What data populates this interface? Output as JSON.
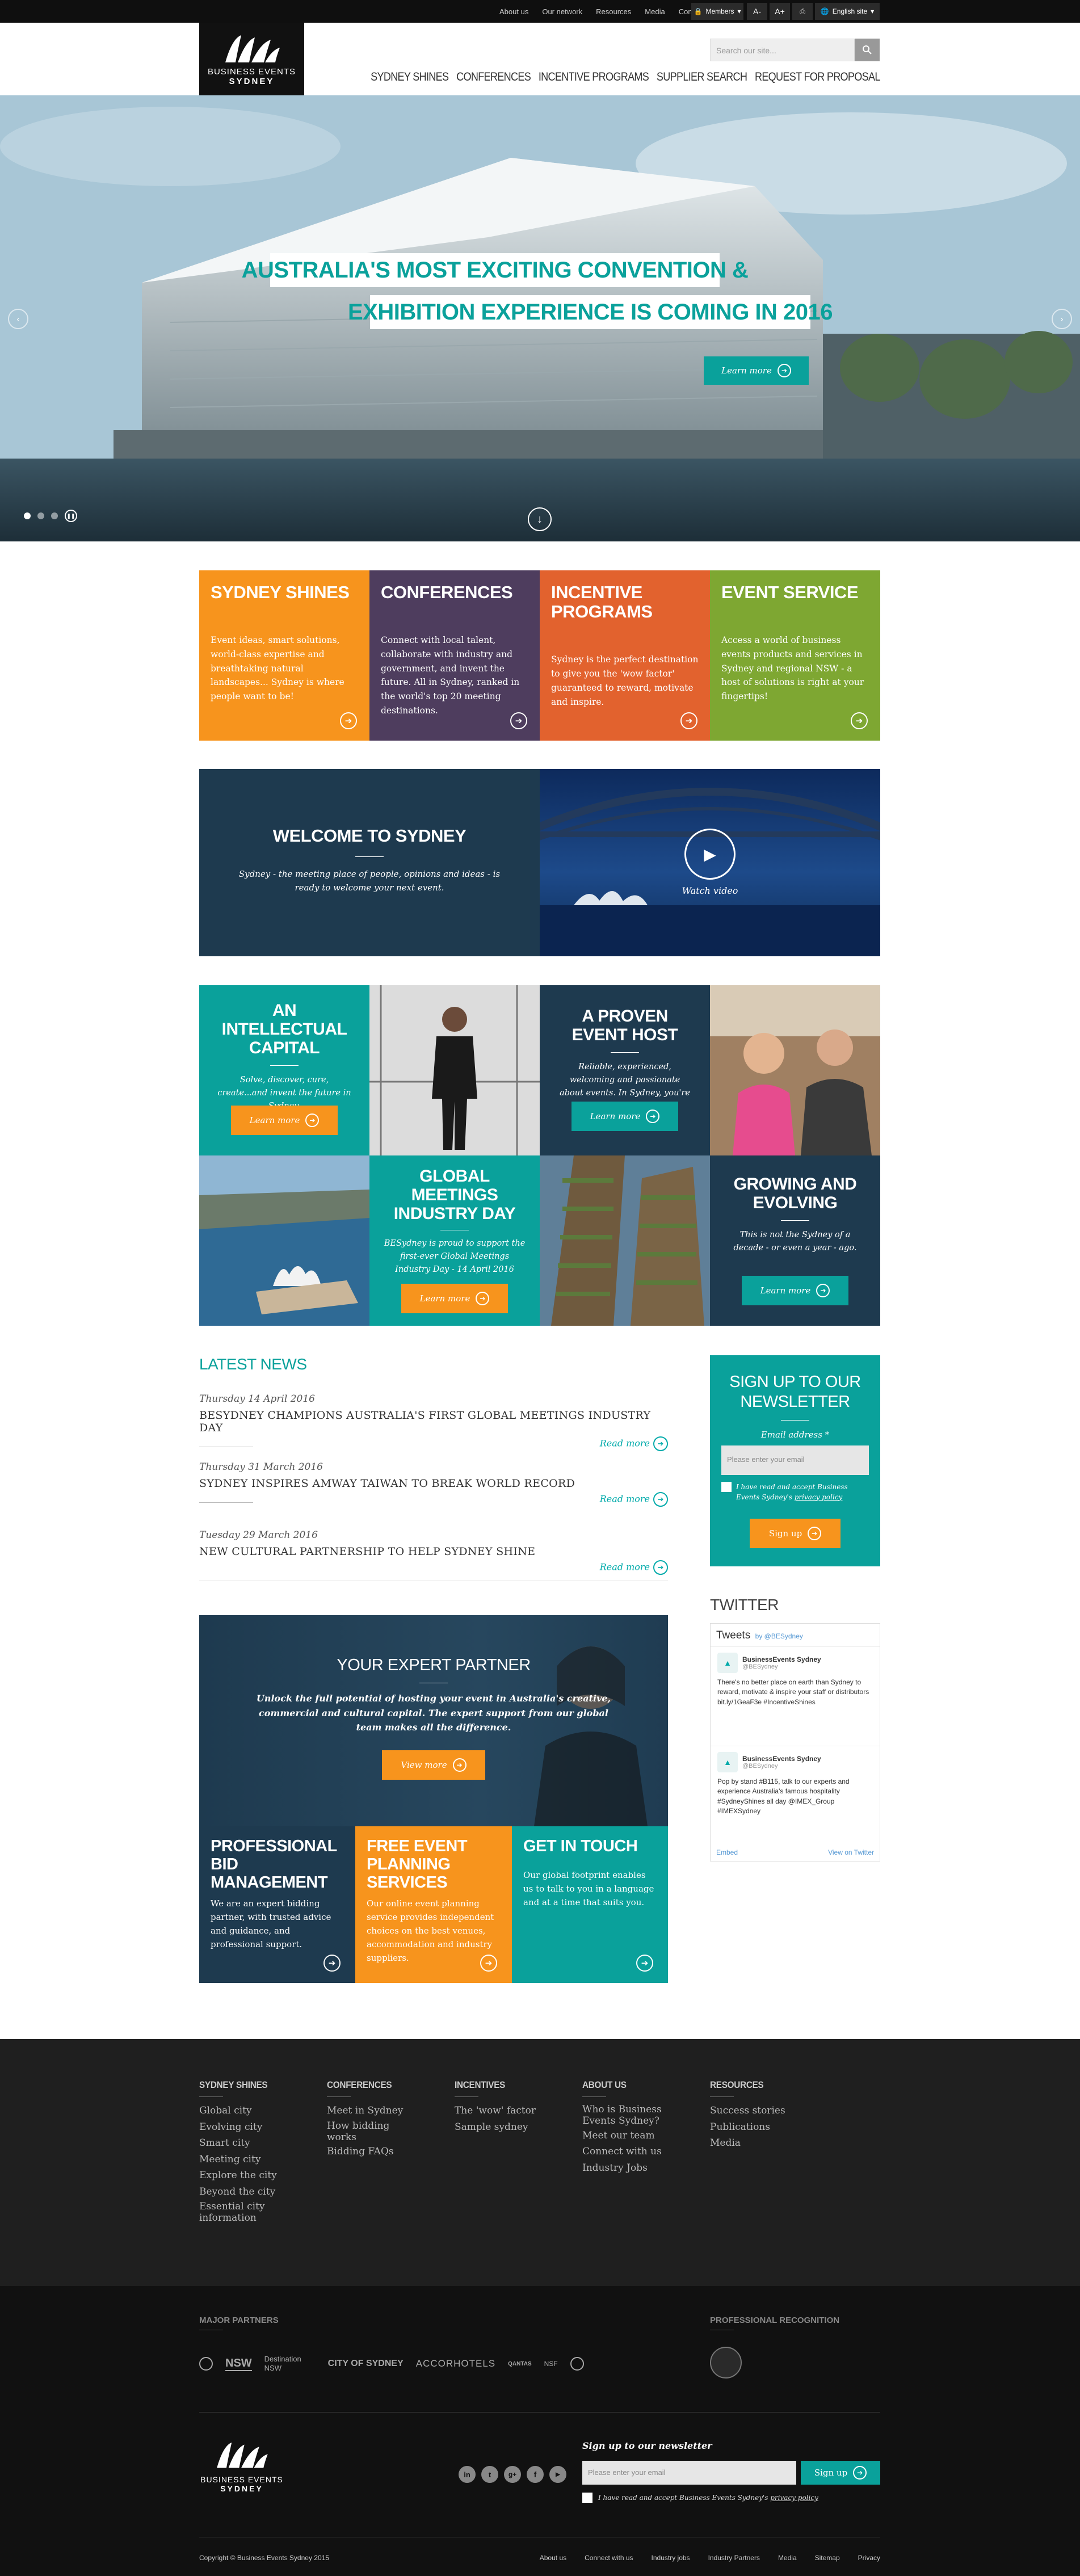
{
  "topbar": {
    "links": [
      "About us",
      "Our network",
      "Resources",
      "Media",
      "Contact"
    ],
    "members_label": "Members",
    "font_small": "A-",
    "font_large": "A+",
    "language_label": "English site"
  },
  "header": {
    "logo_line1": "BUSINESS EVENTS",
    "logo_line2": "SYDNEY",
    "search_placeholder": "Search our site...",
    "nav": [
      "Sydney Shines",
      "Conferences",
      "Incentive Programs",
      "Supplier Search",
      "Request for Proposal"
    ]
  },
  "hero": {
    "headline_line1": "AUSTRALIA'S MOST EXCITING CONVENTION &",
    "headline_line2": "EXHIBITION EXPERIENCE IS COMING IN 2016",
    "cta_label": "Learn more",
    "slide_count": 4,
    "active_slide": 1,
    "accent": "#0aa19b"
  },
  "feature_tiles": [
    {
      "title": "SYDNEY SHINES",
      "text": "Event ideas, smart solutions, world-class expertise and breathtaking natural landscapes... Sydney is where people want to be!",
      "color": "#f7941d"
    },
    {
      "title": "CONFERENCES",
      "text": "Connect with local talent, collaborate with industry and government, and invent the future. All in Sydney, ranked in the world's top 20 meeting destinations.",
      "color": "#4e3d5e"
    },
    {
      "title": "INCENTIVE PROGRAMS",
      "text": "Sydney is the perfect destination to give you the 'wow factor' guaranteed to reward, motivate and inspire.",
      "color": "#e2622e"
    },
    {
      "title": "EVENT SERVICE",
      "text": "Access a world of business events products and services in Sydney and regional NSW - a host of solutions is right at your fingertips!",
      "color": "#7ea732"
    }
  ],
  "welcome": {
    "title": "WELCOME TO SYDNEY",
    "text": "Sydney - the meeting place of people, opinions and ideas - is ready to welcome your next event.",
    "video_label": "Watch video"
  },
  "promo": [
    {
      "title": "AN INTELLECTUAL CAPITAL",
      "text": "Solve, discover, cure, create...and invent the future in Sydney.",
      "cta": "Learn more"
    },
    {
      "title": "A PROVEN EVENT HOST",
      "text": "Reliable, experienced, welcoming and passionate about events. In Sydney, you're in safe hands.",
      "cta": "Learn more"
    },
    {
      "title": "GLOBAL MEETINGS INDUSTRY DAY",
      "text": "BESydney is proud to support the first-ever Global Meetings Industry Day - 14 April 2016",
      "cta": "Learn more"
    },
    {
      "title": "GROWING AND EVOLVING",
      "text": "This is not the Sydney of a decade - or even a year - ago.",
      "cta": "Learn more"
    }
  ],
  "news": {
    "heading": "LATEST NEWS",
    "read_more": "Read more",
    "items": [
      {
        "date": "Thursday 14 April 2016",
        "title": "BESYDNEY CHAMPIONS AUSTRALIA'S FIRST GLOBAL MEETINGS INDUSTRY DAY"
      },
      {
        "date": "Thursday 31 March 2016",
        "title": "SYDNEY INSPIRES AMWAY TAIWAN TO BREAK WORLD RECORD"
      },
      {
        "date": "Tuesday 29 March 2016",
        "title": "NEW CULTURAL PARTNERSHIP TO HELP SYDNEY SHINE"
      }
    ]
  },
  "newsletter_box": {
    "title": "SIGN UP TO OUR NEWSLETTER",
    "email_label": "Email address *",
    "email_placeholder": "Please enter your email",
    "terms_prefix": "I have read and accept Business Events Sydney's",
    "terms_link": "privacy policy",
    "button": "Sign up"
  },
  "twitter": {
    "heading": "TWITTER",
    "widget_title": "Tweets",
    "by": "by @BESydney",
    "tweets": [
      {
        "name": "BusinessEvents Sydney",
        "handle": "@BESydney",
        "text": "There's no better place on earth than Sydney to reward, motivate & inspire your staff or distributors bit.ly/1GeaF3e #IncentiveShines"
      },
      {
        "name": "BusinessEvents Sydney",
        "handle": "@BESydney",
        "text": "Pop by stand #B115, talk to our experts and experience Australia's famous hospitality #SydneyShines all day @IMEX_Group #IMEXSydney"
      }
    ],
    "embed_label": "Embed",
    "view_label": "View on Twitter"
  },
  "expert": {
    "title": "YOUR EXPERT PARTNER",
    "text": "Unlock the full potential of hosting your event in Australia's creative, commercial and cultural capital. The expert support from our global team makes all the difference.",
    "cta": "View more"
  },
  "services": [
    {
      "title": "PROFESSIONAL BID MANAGEMENT",
      "text": "We are an expert bidding partner, with trusted advice and guidance, and professional support.",
      "color": "#1e3a4f"
    },
    {
      "title": "FREE EVENT PLANNING SERVICES",
      "text": "Our online event planning service provides independent choices on the best venues, accommodation and industry suppliers.",
      "color": "#f7941d"
    },
    {
      "title": "GET IN TOUCH",
      "text": "Our global footprint enables us to talk to you in a language and at a time that suits you.",
      "color": "#0aa19b"
    }
  ],
  "footer": {
    "columns": [
      {
        "heading": "SYDNEY SHINES",
        "items": [
          "Global city",
          "Evolving city",
          "Smart city",
          "Meeting city",
          "Explore the city",
          "Beyond the city",
          "Essential city information"
        ]
      },
      {
        "heading": "CONFERENCES",
        "items": [
          "Meet in Sydney",
          "How bidding works",
          "Bidding FAQs"
        ]
      },
      {
        "heading": "INCENTIVES",
        "items": [
          "The 'wow' factor",
          "Sample sydney"
        ]
      },
      {
        "heading": "ABOUT US",
        "items": [
          "Who is Business Events Sydney?",
          "Meet our team",
          "Connect with us",
          "Industry Jobs"
        ]
      },
      {
        "heading": "RESOURCES",
        "items": [
          "Success stories",
          "Publications",
          "Media"
        ]
      }
    ],
    "partners_heading": "MAJOR PARTNERS",
    "partners": [
      "NSW",
      "Destination NSW",
      "CITY OF SYDNEY",
      "ACCORHOTELS",
      "QANTAS",
      "NSF"
    ],
    "recognition_heading": "PROFESSIONAL RECOGNITION",
    "logo_line1": "BUSINESS EVENTS",
    "logo_line2": "SYDNEY",
    "social": [
      "linkedin-icon",
      "twitter-icon",
      "googleplus-icon",
      "facebook-icon",
      "youtube-icon"
    ],
    "newsletter_label": "Sign up to our newsletter",
    "newsletter_placeholder": "Please enter your email",
    "newsletter_button": "Sign up",
    "terms_prefix": "I have read and accept Business Events Sydney's",
    "terms_link": "privacy policy",
    "copyright": "Copyright © Business Events Sydney 2015",
    "bottom_links": [
      "About us",
      "Connect with us",
      "Industry jobs",
      "Industry Partners",
      "Media",
      "Sitemap",
      "Privacy"
    ]
  }
}
